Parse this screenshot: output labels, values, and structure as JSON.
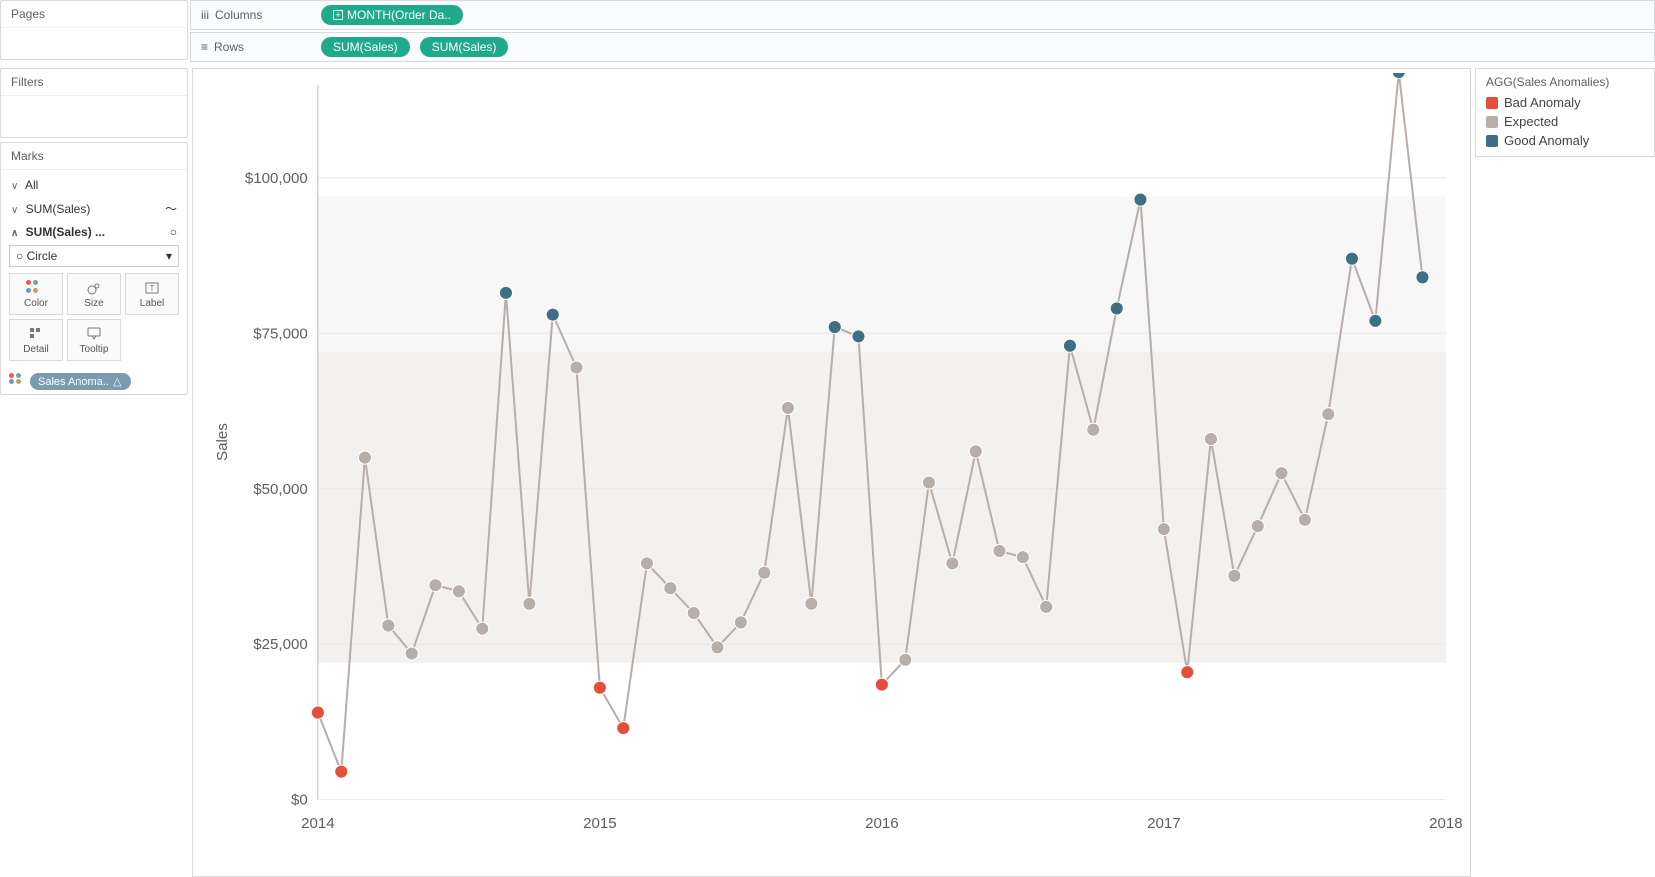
{
  "labels": {
    "pages": "Pages",
    "filters": "Filters",
    "columns": "Columns",
    "rows": "Rows",
    "marks": "Marks",
    "all": "All",
    "sum_sales": "SUM(Sales)",
    "sum_sales_trailing": "SUM(Sales) ...",
    "mark_type": "Circle",
    "mark_color": "Color",
    "mark_size": "Size",
    "mark_label": "Label",
    "mark_detail": "Detail",
    "mark_tooltip": "Tooltip",
    "color_pill": "Sales Anoma..",
    "legend_title": "AGG(Sales Anomalies)",
    "legend_bad": "Bad Anomaly",
    "legend_expected": "Expected",
    "legend_good": "Good Anomaly",
    "y_axis": "Sales",
    "col_pill": "MONTH(Order Da.."
  },
  "colors": {
    "bad": "#e64e3c",
    "expected": "#b7aea9",
    "good": "#3f6f85"
  },
  "chart_data": {
    "type": "line",
    "ylabel": "Sales",
    "xlabel": "",
    "ylim": [
      0,
      115000
    ],
    "y_ticks": [
      0,
      25000,
      50000,
      75000,
      100000
    ],
    "y_tick_labels": [
      "$0",
      "$25,000",
      "$50,000",
      "$75,000",
      "$100,000"
    ],
    "x_range": [
      2014,
      2018
    ],
    "x_ticks": [
      2014,
      2015,
      2016,
      2017,
      2018
    ],
    "reference_bands": [
      {
        "from": 22000,
        "to": 72000,
        "opacity": 0.55
      },
      {
        "from": 72000,
        "to": 97000,
        "opacity": 0.3
      }
    ],
    "series": [
      {
        "name": "Sales",
        "points": [
          {
            "x": 2014.0,
            "y": 14000,
            "cat": "bad"
          },
          {
            "x": 2014.083,
            "y": 4500,
            "cat": "bad"
          },
          {
            "x": 2014.167,
            "y": 55000,
            "cat": "expected"
          },
          {
            "x": 2014.25,
            "y": 28000,
            "cat": "expected"
          },
          {
            "x": 2014.333,
            "y": 23500,
            "cat": "expected"
          },
          {
            "x": 2014.417,
            "y": 34500,
            "cat": "expected"
          },
          {
            "x": 2014.5,
            "y": 33500,
            "cat": "expected"
          },
          {
            "x": 2014.583,
            "y": 27500,
            "cat": "expected"
          },
          {
            "x": 2014.667,
            "y": 81500,
            "cat": "good"
          },
          {
            "x": 2014.75,
            "y": 31500,
            "cat": "expected"
          },
          {
            "x": 2014.833,
            "y": 78000,
            "cat": "good"
          },
          {
            "x": 2014.917,
            "y": 69500,
            "cat": "expected"
          },
          {
            "x": 2015.0,
            "y": 18000,
            "cat": "bad"
          },
          {
            "x": 2015.083,
            "y": 11500,
            "cat": "bad"
          },
          {
            "x": 2015.167,
            "y": 38000,
            "cat": "expected"
          },
          {
            "x": 2015.25,
            "y": 34000,
            "cat": "expected"
          },
          {
            "x": 2015.333,
            "y": 30000,
            "cat": "expected"
          },
          {
            "x": 2015.417,
            "y": 24500,
            "cat": "expected"
          },
          {
            "x": 2015.5,
            "y": 28500,
            "cat": "expected"
          },
          {
            "x": 2015.583,
            "y": 36500,
            "cat": "expected"
          },
          {
            "x": 2015.667,
            "y": 63000,
            "cat": "expected"
          },
          {
            "x": 2015.75,
            "y": 31500,
            "cat": "expected"
          },
          {
            "x": 2015.833,
            "y": 76000,
            "cat": "good"
          },
          {
            "x": 2015.917,
            "y": 74500,
            "cat": "good"
          },
          {
            "x": 2016.0,
            "y": 18500,
            "cat": "bad"
          },
          {
            "x": 2016.083,
            "y": 22500,
            "cat": "expected"
          },
          {
            "x": 2016.167,
            "y": 51000,
            "cat": "expected"
          },
          {
            "x": 2016.25,
            "y": 38000,
            "cat": "expected"
          },
          {
            "x": 2016.333,
            "y": 56000,
            "cat": "expected"
          },
          {
            "x": 2016.417,
            "y": 40000,
            "cat": "expected"
          },
          {
            "x": 2016.5,
            "y": 39000,
            "cat": "expected"
          },
          {
            "x": 2016.583,
            "y": 31000,
            "cat": "expected"
          },
          {
            "x": 2016.667,
            "y": 73000,
            "cat": "good"
          },
          {
            "x": 2016.75,
            "y": 59500,
            "cat": "expected"
          },
          {
            "x": 2016.833,
            "y": 79000,
            "cat": "good"
          },
          {
            "x": 2016.917,
            "y": 96500,
            "cat": "good"
          },
          {
            "x": 2017.0,
            "y": 43500,
            "cat": "expected"
          },
          {
            "x": 2017.083,
            "y": 20500,
            "cat": "bad"
          },
          {
            "x": 2017.167,
            "y": 58000,
            "cat": "expected"
          },
          {
            "x": 2017.25,
            "y": 36000,
            "cat": "expected"
          },
          {
            "x": 2017.333,
            "y": 44000,
            "cat": "expected"
          },
          {
            "x": 2017.417,
            "y": 52500,
            "cat": "expected"
          },
          {
            "x": 2017.5,
            "y": 45000,
            "cat": "expected"
          },
          {
            "x": 2017.583,
            "y": 62000,
            "cat": "expected"
          },
          {
            "x": 2017.667,
            "y": 87000,
            "cat": "good"
          },
          {
            "x": 2017.75,
            "y": 77000,
            "cat": "good"
          },
          {
            "x": 2017.833,
            "y": 117000,
            "cat": "good"
          },
          {
            "x": 2017.917,
            "y": 84000,
            "cat": "good"
          }
        ]
      }
    ]
  }
}
